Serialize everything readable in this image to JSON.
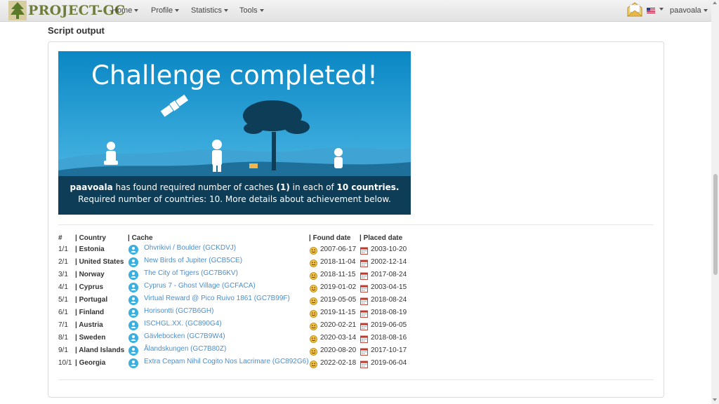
{
  "nav": {
    "brand": "PROJECT-GC",
    "items": [
      "Home",
      "Profile",
      "Statistics",
      "Tools"
    ],
    "user": "paavoala"
  },
  "section_title": "Script output",
  "banner": {
    "headline": "Challenge completed!",
    "line1_user": "paavoala",
    "line1_a": " has found required number of caches ",
    "line1_count": "(1)",
    "line1_b": " in each of ",
    "line1_countries": "10 countries.",
    "line2": "Required number of countries: 10. More details about achievement below."
  },
  "table": {
    "headers": [
      "#",
      "| Country",
      "| Cache",
      "| Found date",
      "| Placed date"
    ],
    "rows": [
      {
        "num": "1/1",
        "country": "| Estonia",
        "cache": "Ohvrikivi / Boulder (GCKDVJ)",
        "found": "2007-06-17",
        "placed": "2003-10-20"
      },
      {
        "num": "2/1",
        "country": "| United States",
        "cache": "New Birds of Jupiter (GCB5CE)",
        "found": "2018-11-04",
        "placed": "2002-12-14"
      },
      {
        "num": "3/1",
        "country": "| Norway",
        "cache": "The City of Tigers (GC7B6KV)",
        "found": "2018-11-15",
        "placed": "2017-08-24"
      },
      {
        "num": "4/1",
        "country": "| Cyprus",
        "cache": "Cyprus 7 - Ghost Village (GCFACA)",
        "found": "2019-01-02",
        "placed": "2003-04-15"
      },
      {
        "num": "5/1",
        "country": "| Portugal",
        "cache": "Virtual Reward @ Pico Ruivo 1861 (GC7B99F)",
        "found": "2019-05-05",
        "placed": "2018-08-24"
      },
      {
        "num": "6/1",
        "country": "| Finland",
        "cache": "Horisontti (GC7B6GH)",
        "found": "2019-11-15",
        "placed": "2018-08-19"
      },
      {
        "num": "7/1",
        "country": "| Austria",
        "cache": "ISCHGL.XX. (GC890G4)",
        "found": "2020-02-21",
        "placed": "2019-06-05"
      },
      {
        "num": "8/1",
        "country": "| Sweden",
        "cache": "Gävlebocken (GC7B9W4)",
        "found": "2020-03-14",
        "placed": "2018-08-16"
      },
      {
        "num": "9/1",
        "country": "| Aland Islands",
        "cache": "Ålandskungen (GC7B80Z)",
        "found": "2020-08-20",
        "placed": "2017-10-17"
      },
      {
        "num": "10/1",
        "country": "| Georgia",
        "cache": "Extra Cepam Nihil Cogito Nos Lacrimare (GC892G6)",
        "found": "2022-02-18",
        "placed": "2019-06-04"
      }
    ]
  },
  "colors": {
    "link": "#4a8fcf",
    "banner_bg": "#0f8fc8",
    "banner_dark": "#0e3d57",
    "cache_icon": "#3bb0e0"
  },
  "icons": {
    "mail": "envelope-icon",
    "flag": "us-flag-icon",
    "cache": "virtual-cache-icon",
    "found": "smiley-icon",
    "placed": "calendar-icon"
  }
}
